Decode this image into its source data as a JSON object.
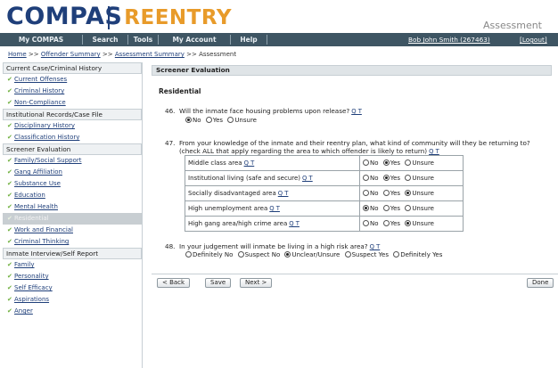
{
  "brand": {
    "name1": "COMPAS",
    "name2": "REENTRY",
    "page_title": "Assessment",
    "accent": "#e89b2a",
    "primary": "#1f3f7a"
  },
  "nav": {
    "items": [
      "My COMPAS",
      "Search",
      "Tools",
      "My Account",
      "Help"
    ],
    "user": "Bob John Smith (267463)",
    "logout": "[Logout]"
  },
  "breadcrumb": {
    "home": "Home",
    "offender": "Offender Summary",
    "assessment_summary": "Assessment Summary",
    "current": "Assessment",
    "sep": ">>"
  },
  "sidebar": {
    "sections": [
      {
        "title": "Current Case/Criminal History",
        "items": [
          "Current Offenses",
          "Criminal History",
          "Non-Compliance"
        ]
      },
      {
        "title": "Institutional Records/Case File",
        "items": [
          "Disciplinary History",
          "Classification History"
        ]
      },
      {
        "title": "Screener Evaluation",
        "items": [
          "Family/Social Support",
          "Gang Affiliation",
          "Substance Use",
          "Education",
          "Mental Health",
          "Residential",
          "Work and Financial",
          "Criminal Thinking"
        ]
      },
      {
        "title": "Inmate Interview/Self Report",
        "items": [
          "Family",
          "Personality",
          "Self Efficacy",
          "Aspirations",
          "Anger"
        ]
      }
    ],
    "active_item": "Residential",
    "check_glyph": "✔"
  },
  "main": {
    "header": "Screener Evaluation",
    "section": "Residential",
    "qt": "Q T",
    "q46": {
      "num": "46.",
      "text": "Will the inmate face housing problems upon release?",
      "options": [
        "No",
        "Yes",
        "Unsure"
      ],
      "selected": "No"
    },
    "q47": {
      "num": "47.",
      "text1": "From your knowledge of the inmate and their reentry plan, what kind of community will they be returning to?",
      "text2": "(check ALL that apply regarding the area to which offender is likely to return)",
      "rows": [
        {
          "label": "Middle class area",
          "selected": "Yes"
        },
        {
          "label": "Institutional living (safe and secure)",
          "selected": "Yes"
        },
        {
          "label": "Socially disadvantaged area",
          "selected": "Unsure"
        },
        {
          "label": "High unemployment area",
          "selected": "No"
        },
        {
          "label": "High gang area/high crime area",
          "selected": "Unsure"
        }
      ],
      "options": [
        "No",
        "Yes",
        "Unsure"
      ]
    },
    "q48": {
      "num": "48.",
      "text": "In your judgement will inmate be living in a high risk area?",
      "options": [
        "Definitely No",
        "Suspect No",
        "Unclear/Unsure",
        "Suspect Yes",
        "Definitely Yes"
      ],
      "selected": "Unclear/Unsure"
    },
    "buttons": {
      "back": "< Back",
      "save": "Save",
      "next": "Next >",
      "done": "Done"
    }
  }
}
